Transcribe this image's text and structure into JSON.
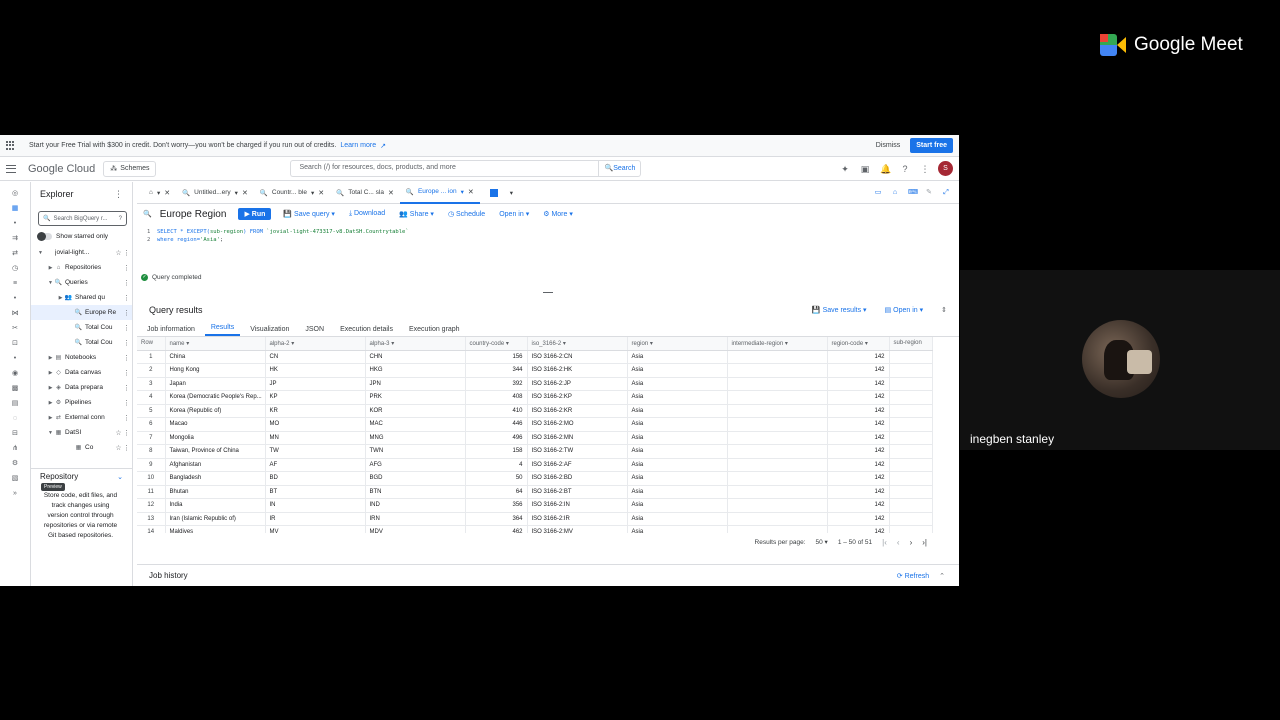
{
  "meet": {
    "logo_text": "Google Meet",
    "participant_name": "inegben stanley"
  },
  "banner": {
    "text": "Start your Free Trial with $300 in credit. Don't worry—you won't be charged if you run out of credits.",
    "link": "Learn more",
    "dismiss": "Dismiss",
    "start": "Start free"
  },
  "topbar": {
    "logo_google": "Google",
    "logo_cloud": "Cloud",
    "project": "Schemes",
    "search_placeholder": "Search (/) for resources, docs, products, and more",
    "search_button": "Search",
    "user_initial": "S"
  },
  "explorer": {
    "title": "Explorer",
    "search_placeholder": "Search BigQuery r...",
    "show_starred": "Show starred only",
    "tree": [
      {
        "label": "jovial-light...",
        "indent": 6,
        "caret": "▼",
        "icon": "",
        "star": true
      },
      {
        "label": "Repositories",
        "indent": 16,
        "caret": "▶",
        "icon": "⌂",
        "star": false
      },
      {
        "label": "Queries",
        "indent": 16,
        "caret": "▼",
        "icon": "🔍",
        "star": false
      },
      {
        "label": "Shared qu",
        "indent": 26,
        "caret": "▶",
        "icon": "👥",
        "star": false
      },
      {
        "label": "Europe Re",
        "indent": 36,
        "caret": "",
        "icon": "🔍",
        "star": false,
        "selected": true
      },
      {
        "label": "Total Cou",
        "indent": 36,
        "caret": "",
        "icon": "🔍",
        "star": false
      },
      {
        "label": "Total Cou",
        "indent": 36,
        "caret": "",
        "icon": "🔍",
        "star": false
      },
      {
        "label": "Notebooks",
        "indent": 16,
        "caret": "▶",
        "icon": "▤",
        "star": false
      },
      {
        "label": "Data canvas",
        "indent": 16,
        "caret": "▶",
        "icon": "◇",
        "star": false
      },
      {
        "label": "Data prepara",
        "indent": 16,
        "caret": "▶",
        "icon": "◈",
        "star": false
      },
      {
        "label": "Pipelines",
        "indent": 16,
        "caret": "▶",
        "icon": "⚙",
        "star": false
      },
      {
        "label": "External conn",
        "indent": 16,
        "caret": "▶",
        "icon": "⇄",
        "star": false
      },
      {
        "label": "DatSI",
        "indent": 16,
        "caret": "▼",
        "icon": "▦",
        "star": true
      },
      {
        "label": "Co",
        "indent": 36,
        "caret": "",
        "icon": "▦",
        "star": true
      }
    ]
  },
  "repository": {
    "title": "Repository",
    "badge": "Preview",
    "description": "Store code, edit files, and track changes using version control through repositories or via remote Git based repositories."
  },
  "tabs": [
    {
      "label": "Untitled...ery",
      "active": false,
      "menu": true
    },
    {
      "label": "Countr... ble",
      "active": false,
      "menu": true
    },
    {
      "label": "Total C... sla",
      "active": false,
      "menu": false
    },
    {
      "label": "Europe ... ion",
      "active": true,
      "menu": true
    }
  ],
  "editor": {
    "title": "Europe Region",
    "run": "Run",
    "save_query": "Save query",
    "download": "Download",
    "share": "Share",
    "schedule": "Schedule",
    "open_in": "Open in",
    "more": "More",
    "line1_kw": "SELECT * EXCEPT(",
    "line1_mid": "sub-region",
    "line1_from": ") FROM ",
    "line1_table": "`jovial-light-473317-v8.DatSH.Countrytable`",
    "line2_kw": "where region=",
    "line2_str": "'Asia'",
    "line2_end": ";",
    "status": "Query completed"
  },
  "results": {
    "title": "Query results",
    "save_results": "Save results",
    "open_in": "Open in",
    "tabs": [
      "Job information",
      "Results",
      "Visualization",
      "JSON",
      "Execution details",
      "Execution graph"
    ],
    "active_tab": 1,
    "columns": [
      "Row",
      "name",
      "alpha-2",
      "alpha-3",
      "country-code",
      "iso_3166-2",
      "region",
      "intermediate-region",
      "region-code",
      "sub-region"
    ],
    "rows": [
      [
        "1",
        "China",
        "CN",
        "CHN",
        "156",
        "ISO 3166-2:CN",
        "Asia",
        "",
        "142"
      ],
      [
        "2",
        "Hong Kong",
        "HK",
        "HKG",
        "344",
        "ISO 3166-2:HK",
        "Asia",
        "",
        "142"
      ],
      [
        "3",
        "Japan",
        "JP",
        "JPN",
        "392",
        "ISO 3166-2:JP",
        "Asia",
        "",
        "142"
      ],
      [
        "4",
        "Korea (Democratic People's Rep...",
        "KP",
        "PRK",
        "408",
        "ISO 3166-2:KP",
        "Asia",
        "",
        "142"
      ],
      [
        "5",
        "Korea (Republic of)",
        "KR",
        "KOR",
        "410",
        "ISO 3166-2:KR",
        "Asia",
        "",
        "142"
      ],
      [
        "6",
        "Macao",
        "MO",
        "MAC",
        "446",
        "ISO 3166-2:MO",
        "Asia",
        "",
        "142"
      ],
      [
        "7",
        "Mongolia",
        "MN",
        "MNG",
        "496",
        "ISO 3166-2:MN",
        "Asia",
        "",
        "142"
      ],
      [
        "8",
        "Taiwan, Province of China",
        "TW",
        "TWN",
        "158",
        "ISO 3166-2:TW",
        "Asia",
        "",
        "142"
      ],
      [
        "9",
        "Afghanistan",
        "AF",
        "AFG",
        "4",
        "ISO 3166-2:AF",
        "Asia",
        "",
        "142"
      ],
      [
        "10",
        "Bangladesh",
        "BD",
        "BGD",
        "50",
        "ISO 3166-2:BD",
        "Asia",
        "",
        "142"
      ],
      [
        "11",
        "Bhutan",
        "BT",
        "BTN",
        "64",
        "ISO 3166-2:BT",
        "Asia",
        "",
        "142"
      ],
      [
        "12",
        "India",
        "IN",
        "IND",
        "356",
        "ISO 3166-2:IN",
        "Asia",
        "",
        "142"
      ],
      [
        "13",
        "Iran (Islamic Republic of)",
        "IR",
        "IRN",
        "364",
        "ISO 3166-2:IR",
        "Asia",
        "",
        "142"
      ],
      [
        "14",
        "Maldives",
        "MV",
        "MDV",
        "462",
        "ISO 3166-2:MV",
        "Asia",
        "",
        "142"
      ]
    ],
    "results_per_page_label": "Results per page:",
    "results_per_page": "50",
    "range": "1 – 50 of 51"
  },
  "job_history": {
    "title": "Job history",
    "refresh": "Refresh"
  },
  "colors": {
    "accent": "#1a73e8",
    "success": "#1e8e3e"
  }
}
